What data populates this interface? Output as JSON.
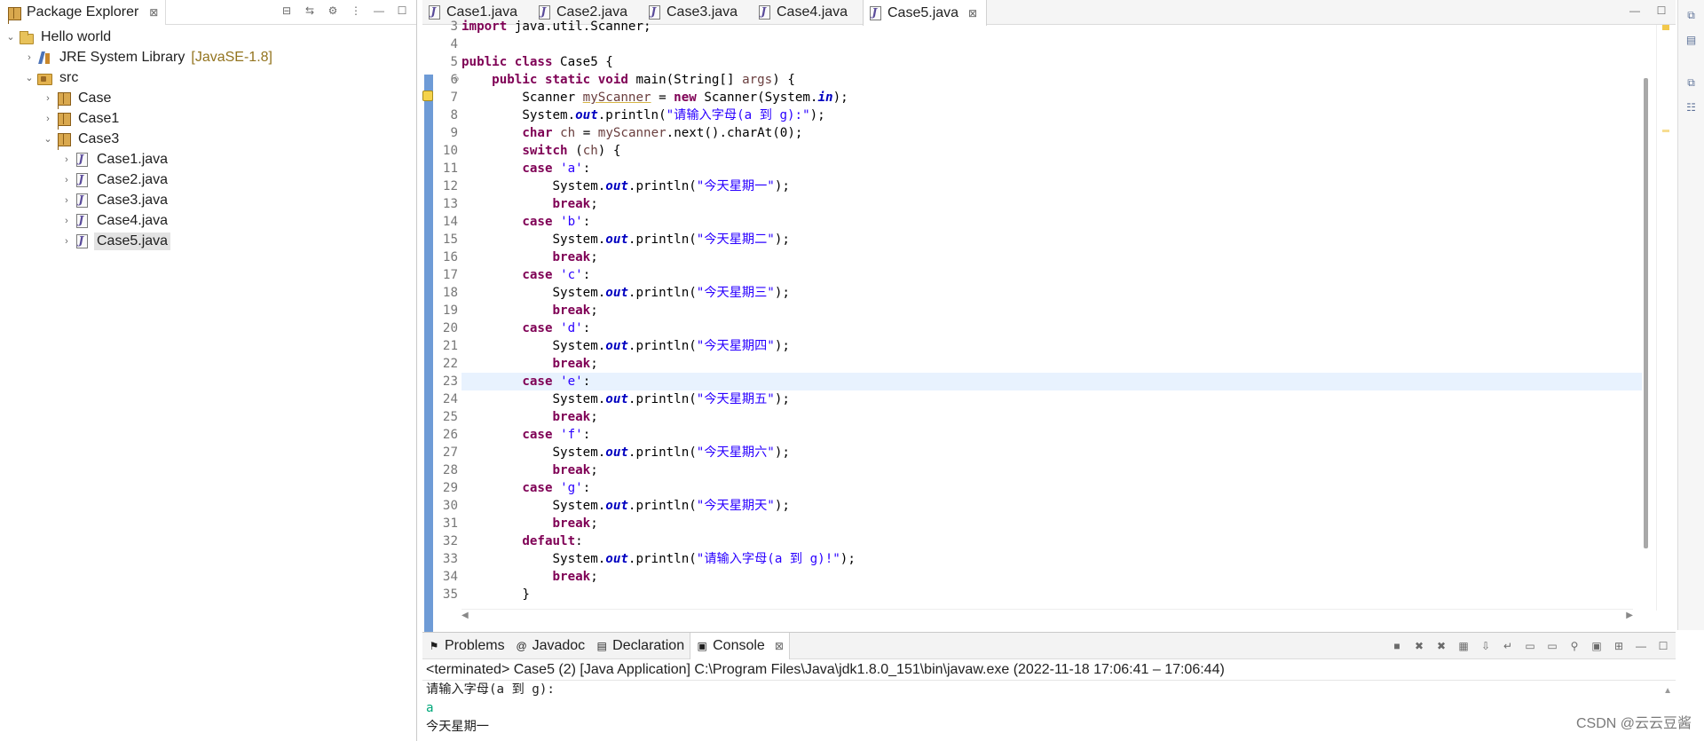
{
  "package_explorer": {
    "title": "Package Explorer",
    "close": "⊠",
    "tree": [
      {
        "label": "Hello world",
        "icon": "project-icon",
        "twist": "⌄",
        "level": 0
      },
      {
        "label": "JRE System Library",
        "decoration": "[JavaSE-1.8]",
        "icon": "library-icon",
        "twist": "›",
        "level": 1
      },
      {
        "label": "src",
        "icon": "source-folder-icon",
        "twist": "⌄",
        "level": 1
      },
      {
        "label": "Case",
        "icon": "package-icon",
        "twist": "›",
        "level": 2
      },
      {
        "label": "Case1",
        "icon": "package-icon",
        "twist": "›",
        "level": 2
      },
      {
        "label": "Case3",
        "icon": "package-icon",
        "twist": "⌄",
        "level": 2
      },
      {
        "label": "Case1.java",
        "icon": "java-file-icon",
        "twist": "›",
        "level": 3
      },
      {
        "label": "Case2.java",
        "icon": "java-file-icon",
        "twist": "›",
        "level": 3
      },
      {
        "label": "Case3.java",
        "icon": "java-file-icon",
        "twist": "›",
        "level": 3
      },
      {
        "label": "Case4.java",
        "icon": "java-file-icon",
        "twist": "›",
        "level": 3
      },
      {
        "label": "Case5.java",
        "icon": "java-file-icon",
        "twist": "›",
        "level": 3,
        "selected": true
      }
    ]
  },
  "editor": {
    "tabs": [
      {
        "label": "Case1.java",
        "active": false
      },
      {
        "label": "Case2.java",
        "active": false
      },
      {
        "label": "Case3.java",
        "active": false
      },
      {
        "label": "Case4.java",
        "active": false
      },
      {
        "label": "Case5.java",
        "active": true
      }
    ],
    "highlight_line": 23,
    "lines": [
      {
        "n": "3",
        "code": "<span class='kw'>import</span> java.util.Scanner;"
      },
      {
        "n": "4",
        "code": ""
      },
      {
        "n": "5",
        "code": "<span class='kw'>public</span> <span class='kw'>class</span> Case5 {"
      },
      {
        "n": "6",
        "code": "    <span class='kw'>public</span> <span class='kw'>static</span> <span class='kw'>void</span> main(String[] <span class='var'>args</span>) {",
        "fold": true
      },
      {
        "n": "7",
        "code": "        Scanner <span class='var warn-var'>myScanner</span> = <span class='kw'>new</span> Scanner(System.<span class='fld'>in</span>);",
        "warning": true
      },
      {
        "n": "8",
        "code": "        System.<span class='fld'>out</span>.println(<span class='str'>\"请输入字母(a 到 g):\"</span>);"
      },
      {
        "n": "9",
        "code": "        <span class='kw'>char</span> <span class='var'>ch</span> = <span class='var'>myScanner</span>.next().charAt(0);"
      },
      {
        "n": "10",
        "code": "        <span class='kw'>switch</span> (<span class='var'>ch</span>) {"
      },
      {
        "n": "11",
        "code": "        <span class='kw'>case</span> <span class='str'>'a'</span>:"
      },
      {
        "n": "12",
        "code": "            System.<span class='fld'>out</span>.println(<span class='str'>\"今天星期一\"</span>);"
      },
      {
        "n": "13",
        "code": "            <span class='kw'>break</span>;"
      },
      {
        "n": "14",
        "code": "        <span class='kw'>case</span> <span class='str'>'b'</span>:"
      },
      {
        "n": "15",
        "code": "            System.<span class='fld'>out</span>.println(<span class='str'>\"今天星期二\"</span>);"
      },
      {
        "n": "16",
        "code": "            <span class='kw'>break</span>;"
      },
      {
        "n": "17",
        "code": "        <span class='kw'>case</span> <span class='str'>'c'</span>:"
      },
      {
        "n": "18",
        "code": "            System.<span class='fld'>out</span>.println(<span class='str'>\"今天星期三\"</span>);"
      },
      {
        "n": "19",
        "code": "            <span class='kw'>break</span>;"
      },
      {
        "n": "20",
        "code": "        <span class='kw'>case</span> <span class='str'>'d'</span>:"
      },
      {
        "n": "21",
        "code": "            System.<span class='fld'>out</span>.println(<span class='str'>\"今天星期四\"</span>);"
      },
      {
        "n": "22",
        "code": "            <span class='kw'>break</span>;"
      },
      {
        "n": "23",
        "code": "        <span class='kw'>case</span> <span class='str'>'e'</span>:"
      },
      {
        "n": "24",
        "code": "            System.<span class='fld'>out</span>.println(<span class='str'>\"今天星期五\"</span>);"
      },
      {
        "n": "25",
        "code": "            <span class='kw'>break</span>;"
      },
      {
        "n": "26",
        "code": "        <span class='kw'>case</span> <span class='str'>'f'</span>:"
      },
      {
        "n": "27",
        "code": "            System.<span class='fld'>out</span>.println(<span class='str'>\"今天星期六\"</span>);"
      },
      {
        "n": "28",
        "code": "            <span class='kw'>break</span>;"
      },
      {
        "n": "29",
        "code": "        <span class='kw'>case</span> <span class='str'>'g'</span>:"
      },
      {
        "n": "30",
        "code": "            System.<span class='fld'>out</span>.println(<span class='str'>\"今天星期天\"</span>);"
      },
      {
        "n": "31",
        "code": "            <span class='kw'>break</span>;"
      },
      {
        "n": "32",
        "code": "        <span class='kw'>default</span>:"
      },
      {
        "n": "33",
        "code": "            System.<span class='fld'>out</span>.println(<span class='str'>\"请输入字母(a 到 g)!\"</span>);"
      },
      {
        "n": "34",
        "code": "            <span class='kw'>break</span>;"
      },
      {
        "n": "35",
        "code": "        }"
      }
    ]
  },
  "bottom_panel": {
    "tabs": [
      {
        "label": "Problems",
        "icon": "problems-icon",
        "glyph": "⚑",
        "active": false
      },
      {
        "label": "Javadoc",
        "icon": "javadoc-icon",
        "glyph": "@",
        "active": false
      },
      {
        "label": "Declaration",
        "icon": "declaration-icon",
        "glyph": "▤",
        "active": false
      },
      {
        "label": "Console",
        "icon": "console-icon",
        "glyph": "▣",
        "active": true
      }
    ],
    "close": "⊠",
    "status": "<terminated> Case5 (2) [Java Application] C:\\Program Files\\Java\\jdk1.8.0_151\\bin\\javaw.exe  (2022-11-18 17:06:41 – 17:06:44)",
    "output": [
      {
        "text": "请输入字母(a 到 g):",
        "kind": "stdout"
      },
      {
        "text": "a",
        "kind": "stdin"
      },
      {
        "text": "今天星期一",
        "kind": "stdout"
      }
    ]
  },
  "watermark": "CSDN @云云豆酱",
  "colors": {
    "keyword": "#7f0055",
    "string": "#2a00ff",
    "field": "#0000c0",
    "local_var": "#6a3e3e",
    "line_highlight": "#e8f2fe",
    "stdin": "#00a87a"
  }
}
